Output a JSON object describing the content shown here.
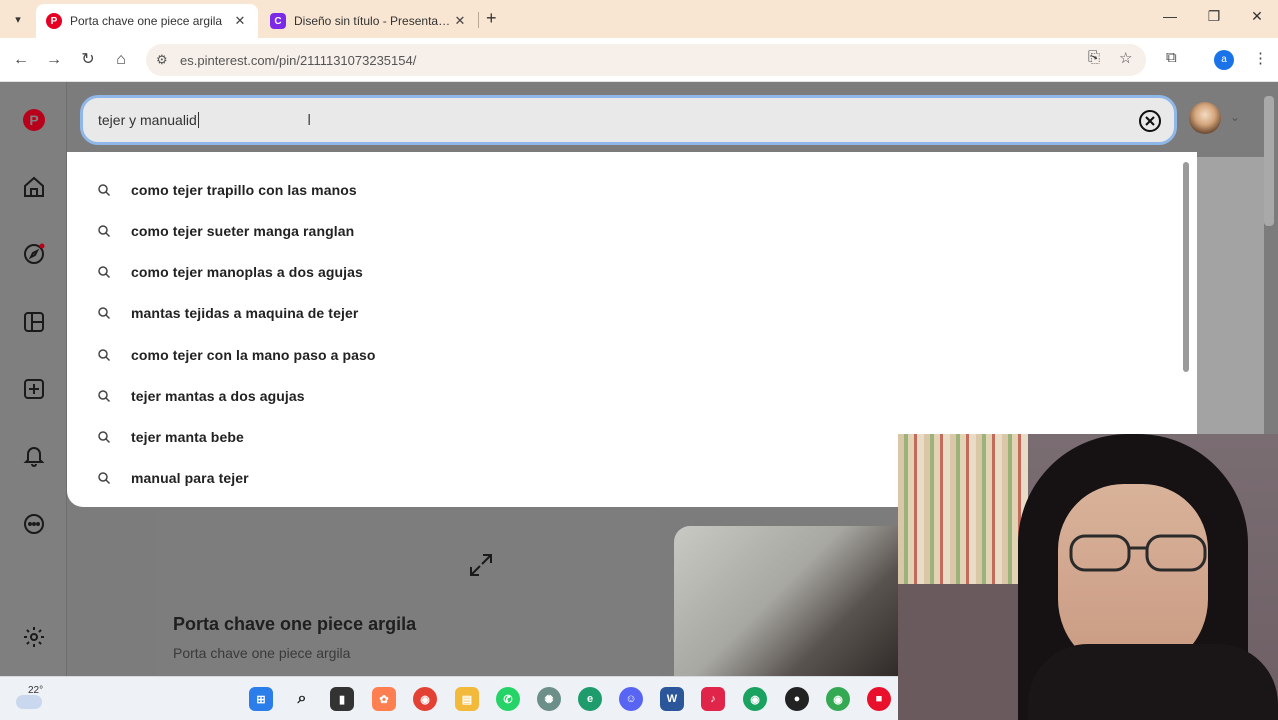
{
  "browser": {
    "tabs": [
      {
        "title": "Porta chave one piece argila",
        "active": true,
        "favicon": "pinterest-icon",
        "color": "#e60023"
      },
      {
        "title": "Diseño sin título - Presentación",
        "active": false,
        "favicon": "canva-icon",
        "color": "#7d2ae8"
      }
    ],
    "url": "es.pinterest.com/pin/2111131073235154/",
    "profile_initial": "a"
  },
  "search": {
    "query": "tejer y manualid",
    "suggestions": [
      "como tejer trapillo con las manos",
      "como tejer sueter manga ranglan",
      "como tejer manoplas a dos agujas",
      "mantas tejidas a maquina de tejer",
      "como tejer con la mano paso a paso",
      "tejer mantas a dos agujas",
      "tejer manta bebe",
      "manual para tejer"
    ]
  },
  "pin": {
    "title": "Porta chave one piece argila",
    "subtitle": "Porta chave one piece argila"
  },
  "taskbar": {
    "temperature": "22°"
  },
  "colors": {
    "pinterest_red": "#e60023",
    "focus_ring": "#8fb8e8"
  }
}
